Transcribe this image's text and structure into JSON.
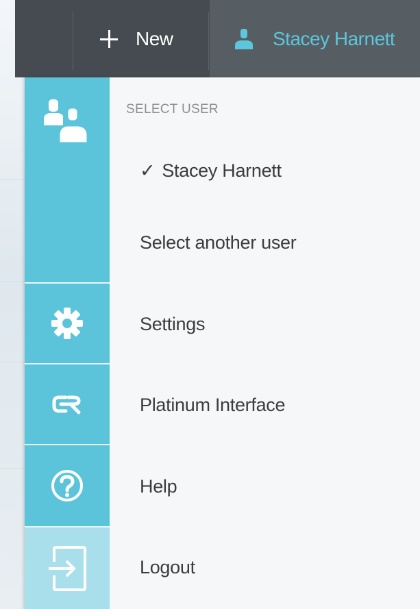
{
  "topbar": {
    "new_label": "New",
    "user_name": "Stacey Harnett"
  },
  "dropdown": {
    "section_title": "SELECT USER",
    "current_user": "Stacey Harnett",
    "check_mark": "✓",
    "items": {
      "select_another": "Select another user",
      "settings": "Settings",
      "platinum": "Platinum Interface",
      "help": "Help",
      "logout": "Logout"
    },
    "icons": {
      "users": "users-icon",
      "settings": "gear-icon",
      "platinum": "cr-logo-icon",
      "help": "question-circle-icon",
      "logout": "sign-out-icon"
    },
    "colors": {
      "accent": "#5bc4da",
      "accent_faded": "#a9dfea",
      "user_name": "#5bc6dc",
      "topbar": "#454b50",
      "topbar_active": "#575e63"
    }
  }
}
